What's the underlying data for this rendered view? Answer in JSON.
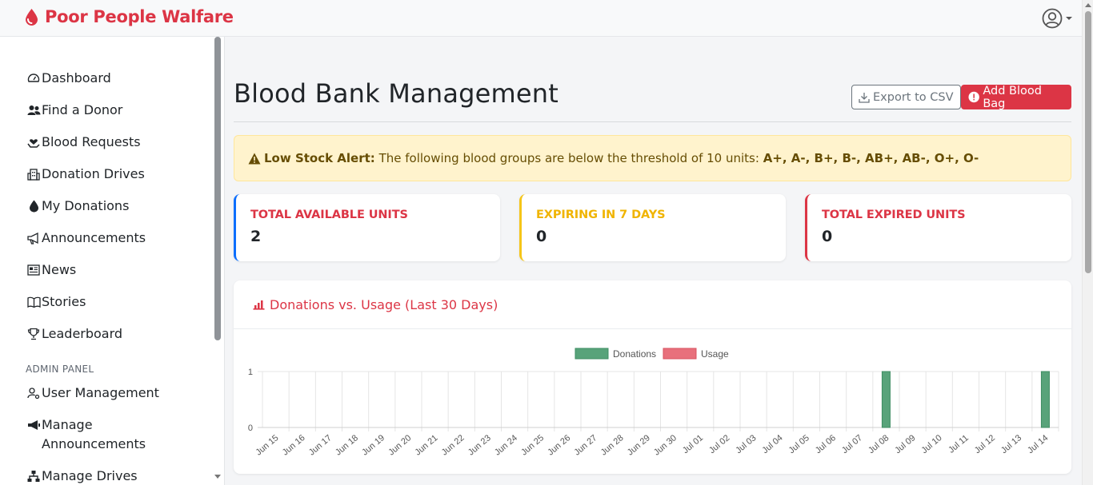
{
  "brand": {
    "name": "Poor People Walfare",
    "color": "#dc3545"
  },
  "navbar": {
    "user_icon": "user-circle-icon"
  },
  "sidebar": {
    "items": [
      {
        "label": "Dashboard",
        "icon": "gauge-icon"
      },
      {
        "label": "Find a Donor",
        "icon": "users-icon"
      },
      {
        "label": "Blood Requests",
        "icon": "hand-holding-heart-icon"
      },
      {
        "label": "Donation Drives",
        "icon": "building-icon"
      },
      {
        "label": "My Donations",
        "icon": "droplet-icon"
      },
      {
        "label": "Announcements",
        "icon": "megaphone-icon"
      },
      {
        "label": "News",
        "icon": "newspaper-icon"
      },
      {
        "label": "Stories",
        "icon": "book-open-icon"
      },
      {
        "label": "Leaderboard",
        "icon": "trophy-icon"
      }
    ],
    "admin_label": "ADMIN PANEL",
    "admin_items": [
      {
        "label": "User Management",
        "icon": "user-gear-icon"
      },
      {
        "label": "Manage Announcements",
        "icon": "bullhorn-icon"
      },
      {
        "label": "Manage Drives",
        "icon": "sitemap-icon"
      }
    ]
  },
  "page": {
    "title": "Blood Bank Management",
    "export_label": "Export to CSV",
    "add_label": "Add Blood Bag"
  },
  "alert": {
    "title": "Low Stock Alert:",
    "message": "The following blood groups are below the threshold of 10 units:",
    "groups": "A+, A-, B+, B-, AB+, AB-, O+, O-"
  },
  "stats": [
    {
      "label": "TOTAL AVAILABLE UNITS",
      "value": "2"
    },
    {
      "label": "EXPIRING IN 7 DAYS",
      "value": "0"
    },
    {
      "label": "TOTAL EXPIRED UNITS",
      "value": "0"
    }
  ],
  "chart_card": {
    "title": "Donations vs. Usage (Last 30 Days)"
  },
  "chart_data": {
    "type": "bar",
    "categories": [
      "Jun 15",
      "Jun 16",
      "Jun 17",
      "Jun 18",
      "Jun 19",
      "Jun 20",
      "Jun 21",
      "Jun 22",
      "Jun 23",
      "Jun 24",
      "Jun 25",
      "Jun 26",
      "Jun 27",
      "Jun 28",
      "Jun 29",
      "Jun 30",
      "Jul 01",
      "Jul 02",
      "Jul 03",
      "Jul 04",
      "Jul 05",
      "Jul 06",
      "Jul 07",
      "Jul 08",
      "Jul 09",
      "Jul 10",
      "Jul 11",
      "Jul 12",
      "Jul 13",
      "Jul 14"
    ],
    "series": [
      {
        "name": "Donations",
        "color": "#58a37a",
        "values": [
          0,
          0,
          0,
          0,
          0,
          0,
          0,
          0,
          0,
          0,
          0,
          0,
          0,
          0,
          0,
          0,
          0,
          0,
          0,
          0,
          0,
          0,
          0,
          1,
          0,
          0,
          0,
          0,
          0,
          1
        ]
      },
      {
        "name": "Usage",
        "color": "#e8707c",
        "values": [
          0,
          0,
          0,
          0,
          0,
          0,
          0,
          0,
          0,
          0,
          0,
          0,
          0,
          0,
          0,
          0,
          0,
          0,
          0,
          0,
          0,
          0,
          0,
          0,
          0,
          0,
          0,
          0,
          0,
          0
        ]
      }
    ],
    "ylim": [
      0,
      1
    ],
    "yticks": [
      "0",
      "1"
    ],
    "legend": "top-center",
    "grid": true
  }
}
